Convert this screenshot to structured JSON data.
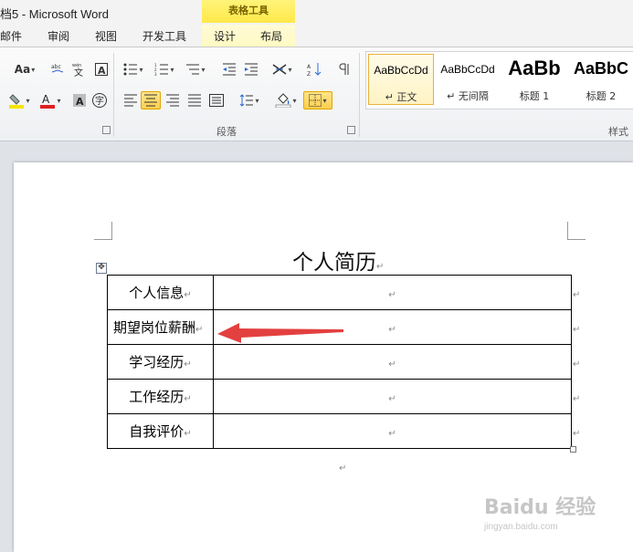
{
  "window": {
    "title": "档5 - Microsoft Word",
    "context_tab_group": "表格工具"
  },
  "tabs": [
    "邮件",
    "审阅",
    "视图",
    "开发工具",
    "设计",
    "布局"
  ],
  "ribbon": {
    "group_paragraph": "段落",
    "group_styles": "样式",
    "font_size_aa": "Aa",
    "styles": [
      {
        "preview": "AaBbCcDd",
        "name": "↵ 正文",
        "selected": true
      },
      {
        "preview": "AaBbCcDd",
        "name": "↵ 无间隔",
        "selected": false
      },
      {
        "preview": "AaBb",
        "name": "标题 1",
        "selected": false
      },
      {
        "preview": "AaBbC",
        "name": "标题 2",
        "selected": false
      }
    ],
    "colors": {
      "highlight": "#f5e50a",
      "font_color": "#e02020",
      "selected": "#ffd24d"
    }
  },
  "document": {
    "title": "个人简历",
    "paragraph_mark": "↵",
    "rows": [
      {
        "label": "个人信息",
        "value": ""
      },
      {
        "label": "期望岗位薪酬",
        "value": ""
      },
      {
        "label": "学习经历",
        "value": ""
      },
      {
        "label": "工作经历",
        "value": ""
      },
      {
        "label": "自我评价",
        "value": ""
      }
    ],
    "annotation_arrow_color": "#e34040"
  },
  "watermark": {
    "logo": "Baidu 经验",
    "url": "jingyan.baidu.com"
  }
}
